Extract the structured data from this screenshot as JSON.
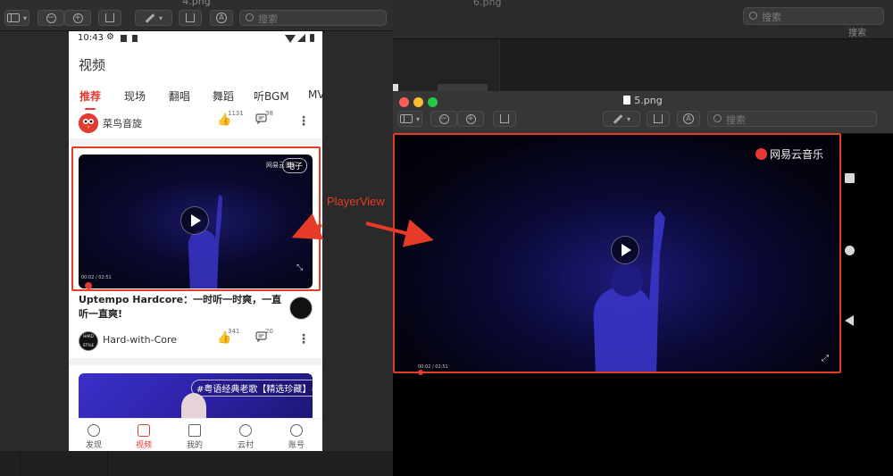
{
  "window_left": {
    "title": "4.png",
    "search_placeholder": "搜索"
  },
  "window_background": {
    "title": "6.png",
    "search_placeholder": "搜索",
    "search_label": "搜索"
  },
  "window_right": {
    "title": "5.png",
    "search_placeholder": "搜索",
    "brand": "网易云音乐",
    "time": "00:02 / 02:51"
  },
  "annotation": {
    "label": "PlayerView",
    "color": "#e53b27"
  },
  "phone": {
    "status_time": "10:43",
    "page_title": "视频",
    "tabs": [
      "推荐",
      "现场",
      "翻唱",
      "舞蹈",
      "听BGM",
      "MV"
    ],
    "feed1": {
      "user": "菜鸟音旋",
      "likes": "1131",
      "comments": "38"
    },
    "video_card": {
      "genre_tag": "电子",
      "brand": "网易云音乐",
      "time": "00:02 / 02:51"
    },
    "video_title": "Uptempo Hardcore：一时听一时爽，一直听一直爽!",
    "feed2": {
      "user": "Hard-with-Core",
      "avatar_text": "HARD STYLE",
      "likes": "341",
      "comments": "20"
    },
    "card2_tag": "#粤语经典老歌【精选珍藏】#",
    "bottom_nav": [
      "发现",
      "视频",
      "我的",
      "云村",
      "账号"
    ],
    "accent": "#e53935"
  }
}
